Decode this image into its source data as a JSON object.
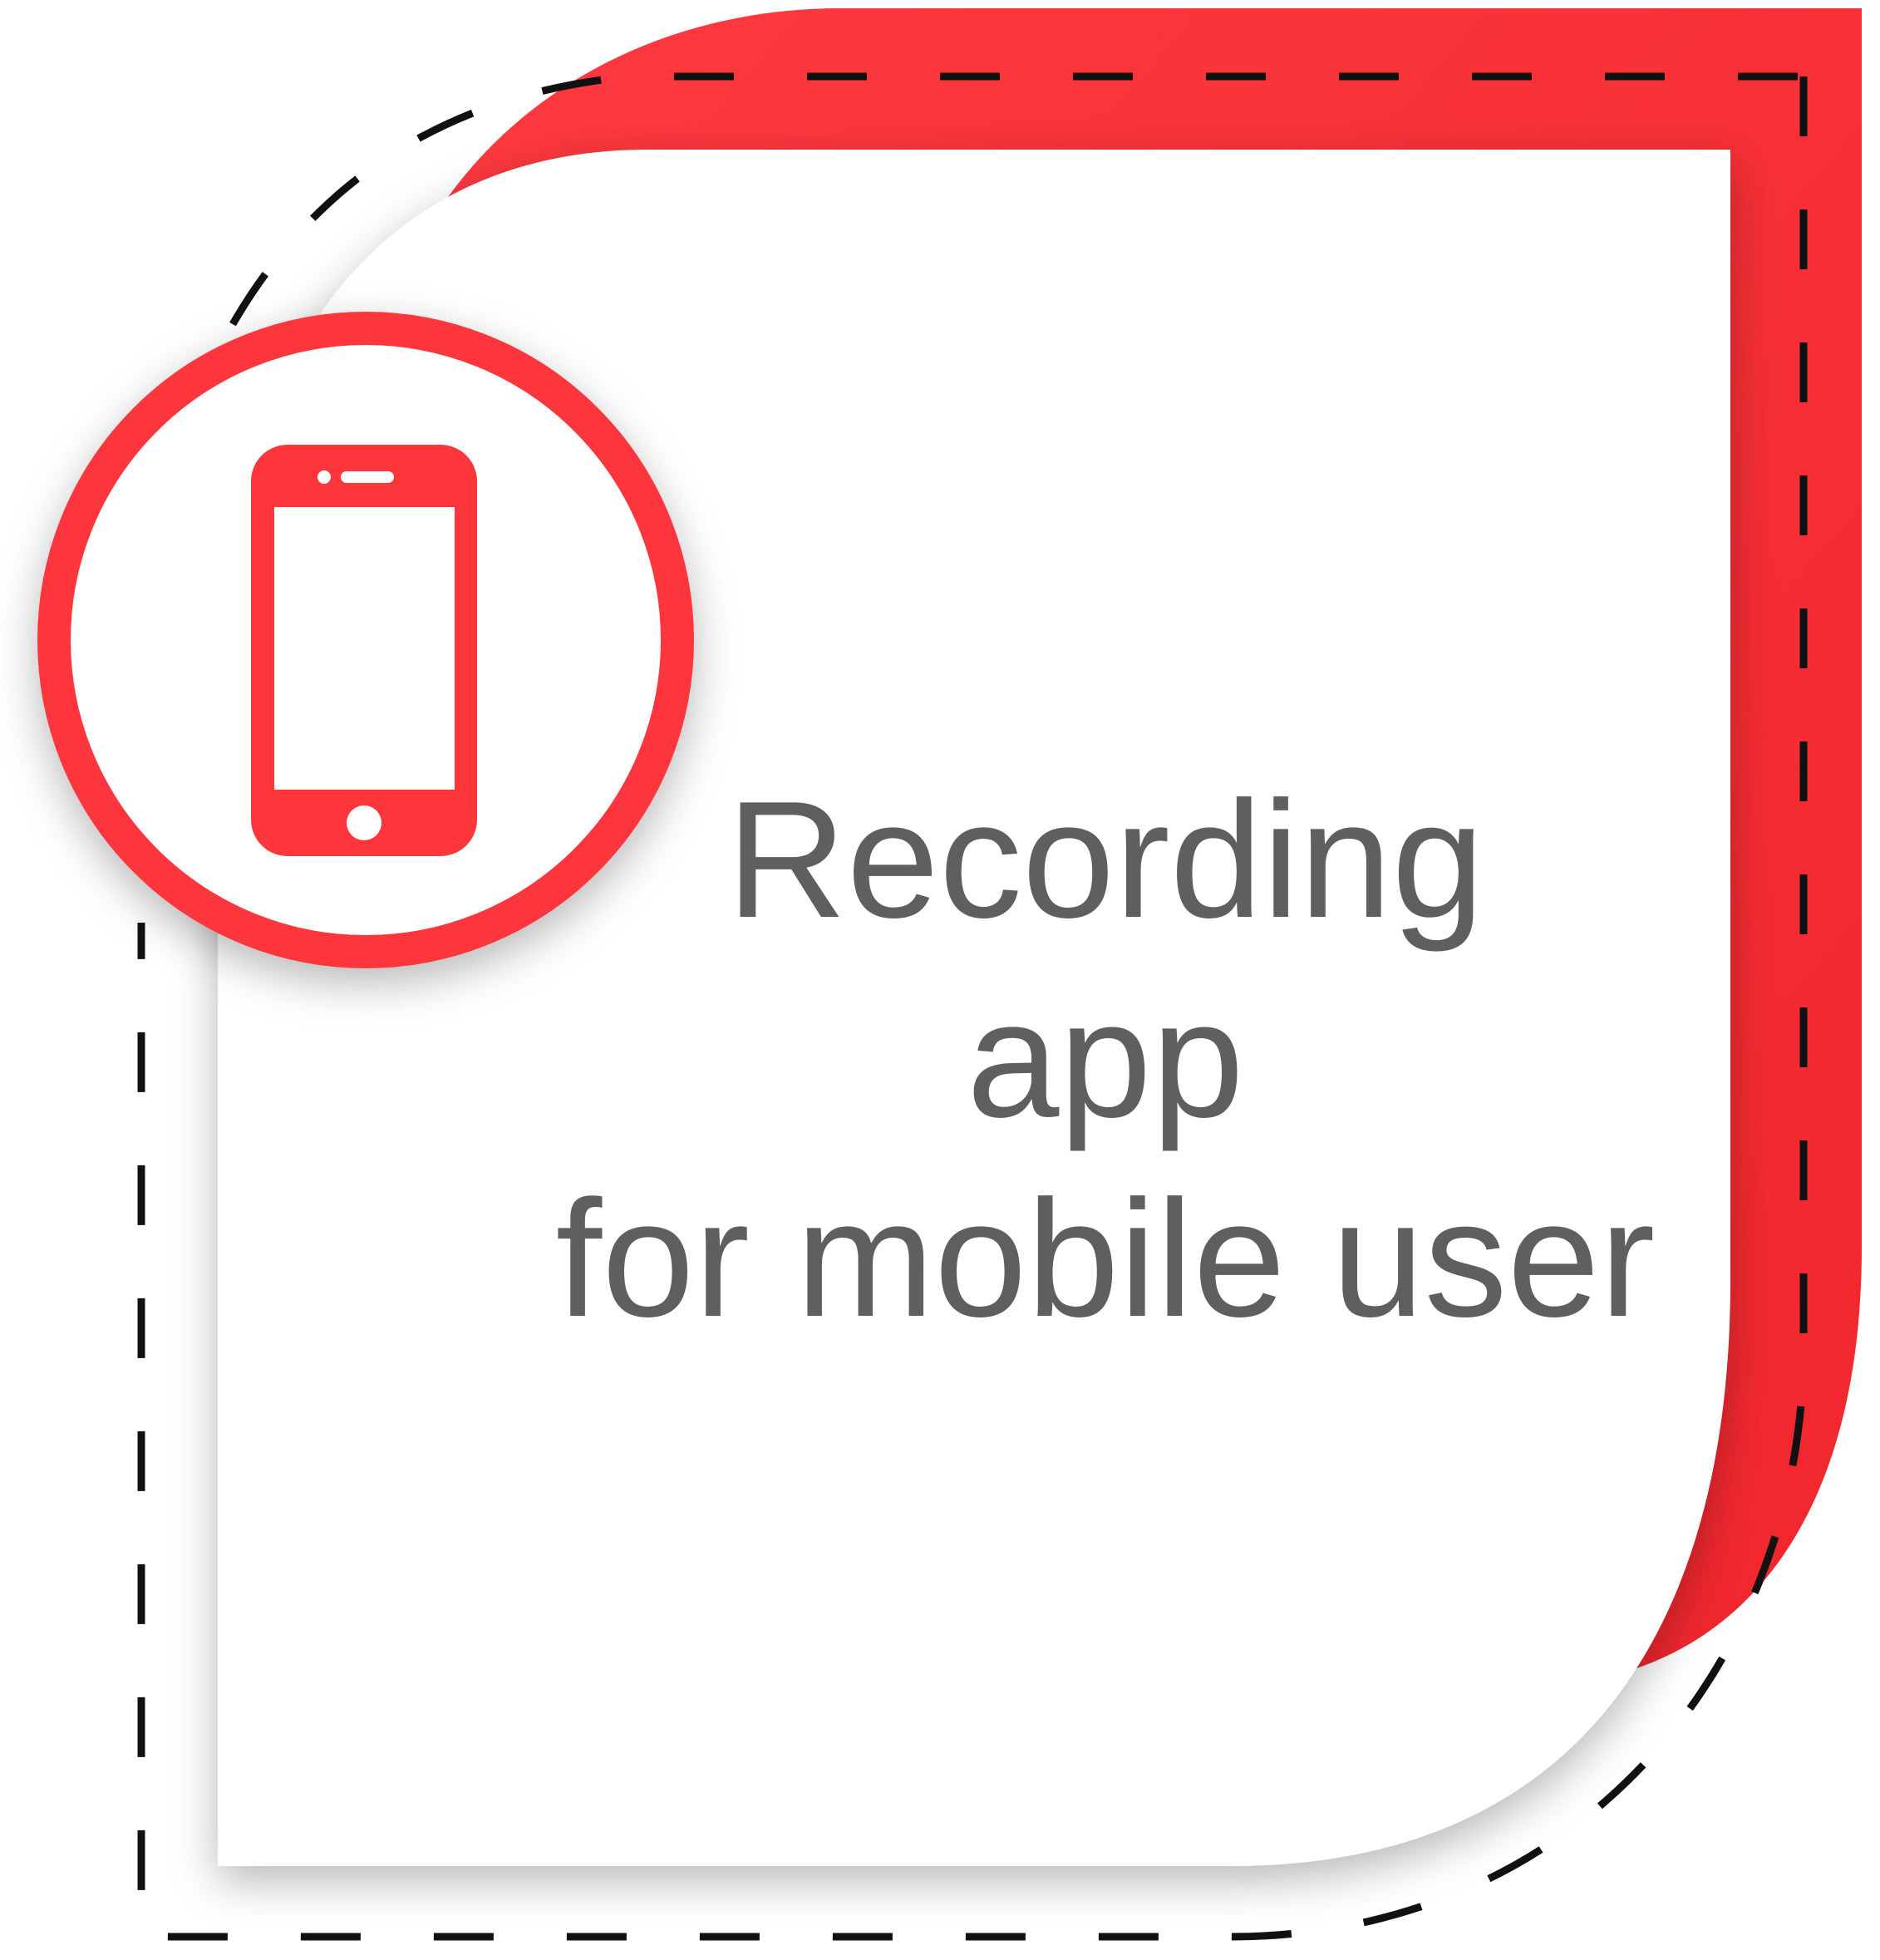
{
  "card": {
    "accent_color": "#fd363c",
    "text_color": "#5f5f5f",
    "icon": "mobile-phone-icon",
    "caption_lines": [
      "Recording",
      "app",
      "for mobile user"
    ]
  }
}
